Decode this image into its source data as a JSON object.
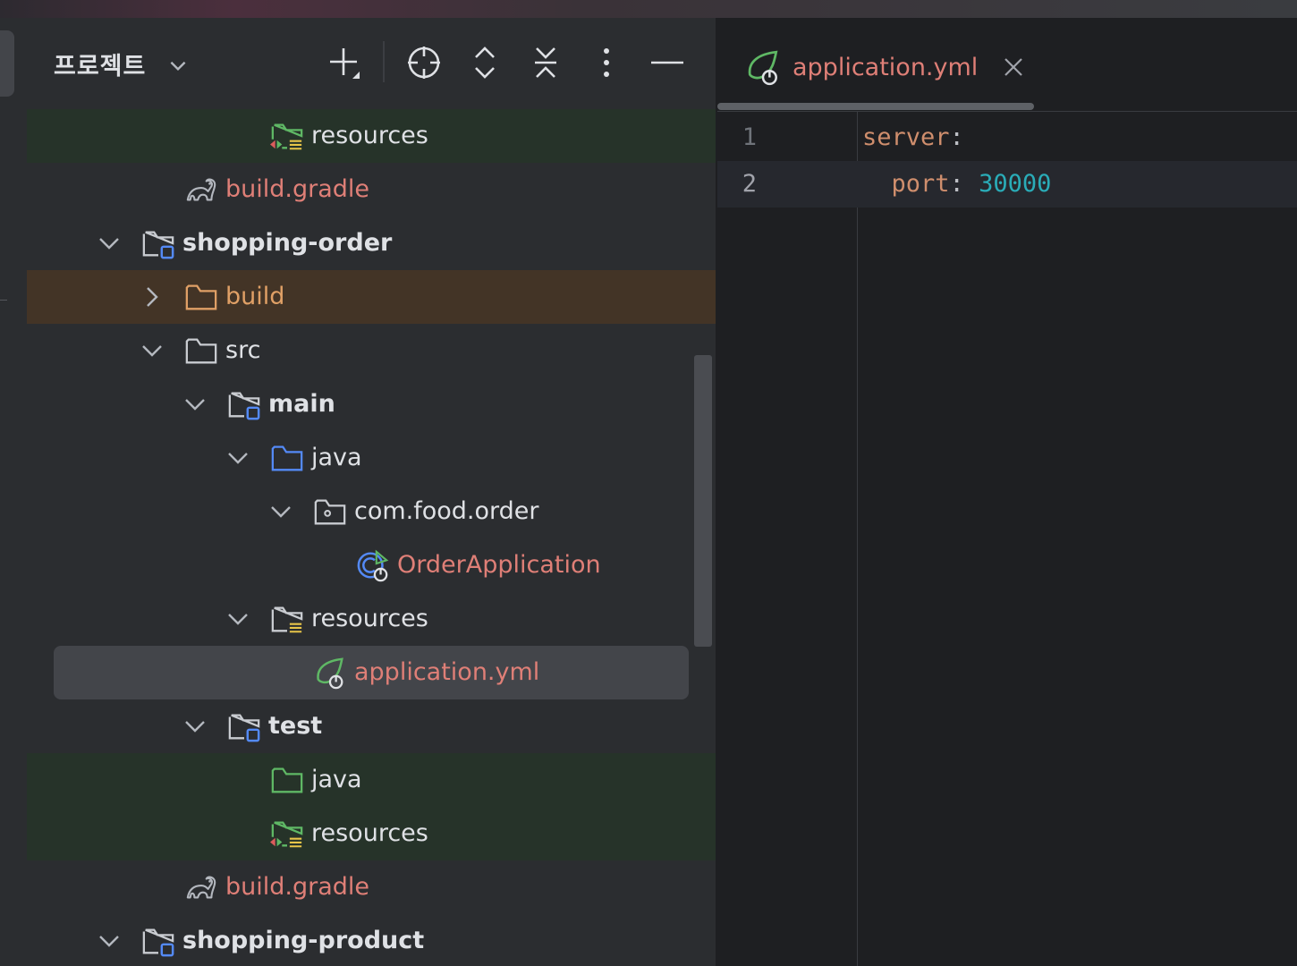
{
  "panel": {
    "title": "프로젝트",
    "toolbar": [
      "add-icon",
      "locate-icon",
      "expand-all-icon",
      "collapse-all-icon",
      "more-icon",
      "hide-icon"
    ]
  },
  "tree": [
    {
      "label": "resources",
      "icon": "resources-test-folder-icon",
      "bold": false,
      "color": "#dfe1e5",
      "bg": "green"
    },
    {
      "label": "build.gradle",
      "icon": "gradle-icon",
      "bold": false,
      "color": "#df7f77"
    },
    {
      "label": "shopping-order",
      "icon": "module-folder-icon",
      "bold": true,
      "color": "#dfe1e5",
      "chevron": "down"
    },
    {
      "label": "build",
      "icon": "excluded-folder-icon",
      "bold": false,
      "color": "#e0a066",
      "chevron": "right",
      "bg": "orange"
    },
    {
      "label": "src",
      "icon": "folder-icon",
      "bold": false,
      "color": "#dfe1e5",
      "chevron": "down"
    },
    {
      "label": "main",
      "icon": "module-folder-icon",
      "bold": true,
      "color": "#dfe1e5",
      "chevron": "down"
    },
    {
      "label": "java",
      "icon": "source-folder-icon",
      "bold": false,
      "color": "#dfe1e5",
      "chevron": "down"
    },
    {
      "label": "com.food.order",
      "icon": "package-icon",
      "bold": false,
      "color": "#dfe1e5",
      "chevron": "down"
    },
    {
      "label": "OrderApplication",
      "icon": "spring-boot-class-icon",
      "bold": false,
      "color": "#df7f77"
    },
    {
      "label": "resources",
      "icon": "resources-folder-icon",
      "bold": false,
      "color": "#dfe1e5",
      "chevron": "down"
    },
    {
      "label": "application.yml",
      "icon": "spring-config-icon",
      "bold": false,
      "color": "#df7f77",
      "selected": true
    },
    {
      "label": "test",
      "icon": "module-folder-icon",
      "bold": true,
      "color": "#dfe1e5",
      "chevron": "down"
    },
    {
      "label": "java",
      "icon": "test-folder-icon",
      "bold": false,
      "color": "#dfe1e5",
      "bg": "green"
    },
    {
      "label": "resources",
      "icon": "resources-test-folder-icon",
      "bold": false,
      "color": "#dfe1e5",
      "bg": "green"
    },
    {
      "label": "build.gradle",
      "icon": "gradle-icon",
      "bold": false,
      "color": "#df7f77"
    },
    {
      "label": "shopping-product",
      "icon": "module-folder-icon",
      "bold": true,
      "color": "#dfe1e5",
      "chevron": "down"
    }
  ],
  "editor": {
    "tab_label": "application.yml",
    "lines": [
      {
        "num": "1",
        "tokens": [
          {
            "t": "server",
            "c": "k"
          },
          {
            "t": ":",
            "c": "p"
          }
        ]
      },
      {
        "num": "2",
        "tokens": [
          {
            "t": "  port",
            "c": "k"
          },
          {
            "t": ": ",
            "c": "p"
          },
          {
            "t": "30000",
            "c": "n"
          }
        ]
      }
    ]
  },
  "colors": {
    "accent_blue": "#548af7",
    "spring_green": "#5fb865",
    "gradle": "#b4b8bf"
  }
}
